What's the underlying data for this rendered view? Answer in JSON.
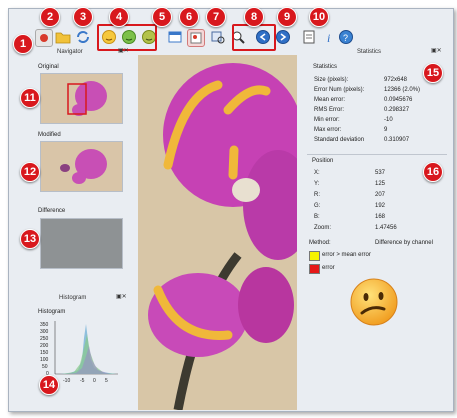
{
  "toolbar": {
    "icons": [
      "record-icon",
      "folder-icon",
      "refresh-icon",
      "smiley-yellow-icon",
      "smiley-green-icon",
      "smiley-olive-icon",
      "window-icon",
      "image-icon",
      "zoom-image-icon",
      "zoom-out-icon",
      "prev-icon",
      "next-icon",
      "document-icon",
      "info-icon",
      "help-icon"
    ]
  },
  "callouts": [
    "1",
    "2",
    "3",
    "4",
    "5",
    "6",
    "7",
    "8",
    "9",
    "10",
    "11",
    "12",
    "13",
    "14",
    "15",
    "16"
  ],
  "navigator": {
    "title": "Navigator",
    "original_label": "Original",
    "modified_label": "Modified",
    "difference_label": "Difference"
  },
  "histogram": {
    "title": "Histogram",
    "label": "Histogram",
    "y_ticks": [
      "350",
      "300",
      "250",
      "200",
      "150",
      "100",
      "50",
      "0"
    ],
    "x_ticks": [
      "-10",
      "-5",
      "0",
      "5"
    ]
  },
  "statistics": {
    "title": "Statistics",
    "group_label": "Statistics",
    "rows": [
      {
        "label": "Size (pixels):",
        "value": "972x648"
      },
      {
        "label": "Error Num (pixels):",
        "value": "12366 (2.0%)"
      },
      {
        "label": "Mean error:",
        "value": "0.0945676"
      },
      {
        "label": "RMS Error:",
        "value": "0.298327"
      },
      {
        "label": "Min error:",
        "value": "-10"
      },
      {
        "label": "Max error:",
        "value": "9"
      },
      {
        "label": "Standard deviation",
        "value": "0.310907"
      }
    ]
  },
  "position": {
    "group_label": "Position",
    "rows": [
      {
        "label": "X:",
        "value": "537"
      },
      {
        "label": "Y:",
        "value": "125"
      },
      {
        "label": "R:",
        "value": "207"
      },
      {
        "label": "G:",
        "value": "192"
      },
      {
        "label": "B:",
        "value": "168"
      },
      {
        "label": "Zoom:",
        "value": "1.47456"
      }
    ]
  },
  "method": {
    "label": "Method:",
    "value": "Difference by channel",
    "legend": [
      {
        "text": "error > mean error",
        "color": "#f6f200"
      },
      {
        "text": "error",
        "color": "#e51818"
      }
    ]
  },
  "colors": {
    "accent": "#d8181d",
    "window_bg": "#e9edf2",
    "flower": "#c43fb0",
    "error_mark": "#f0b83a"
  }
}
